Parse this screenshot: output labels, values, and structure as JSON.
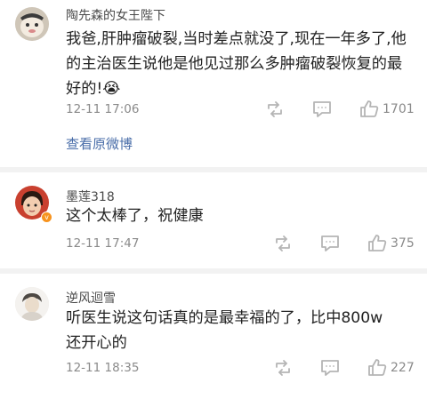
{
  "comments": [
    {
      "user": "陶先森的女王陛下",
      "text": "我爸,肝肿瘤破裂,当时差点就没了,现在一年多了,他的主治医生说他是他见过那么多肿瘤破裂恢复的最好的!😭",
      "time": "12-11 17:06",
      "likes": "1701",
      "link": "查看原微博"
    },
    {
      "user": "墨莲318",
      "text": "这个太棒了，祝健康",
      "time": "12-11 17:47",
      "likes": "375"
    },
    {
      "user": "逆风迴雪",
      "text": "听医生说这句话真的是最幸福的了，比中800w还开心的",
      "time": "12-11 18:35",
      "likes": "227"
    }
  ],
  "icons": {
    "repost": "repost-icon",
    "comment": "comment-icon",
    "like": "thumbs-up-icon",
    "verified": "verified-badge-icon"
  },
  "colors": {
    "link": "#4a6ea9",
    "icon": "#b5b5b5",
    "divider": "#f2f2f2"
  }
}
